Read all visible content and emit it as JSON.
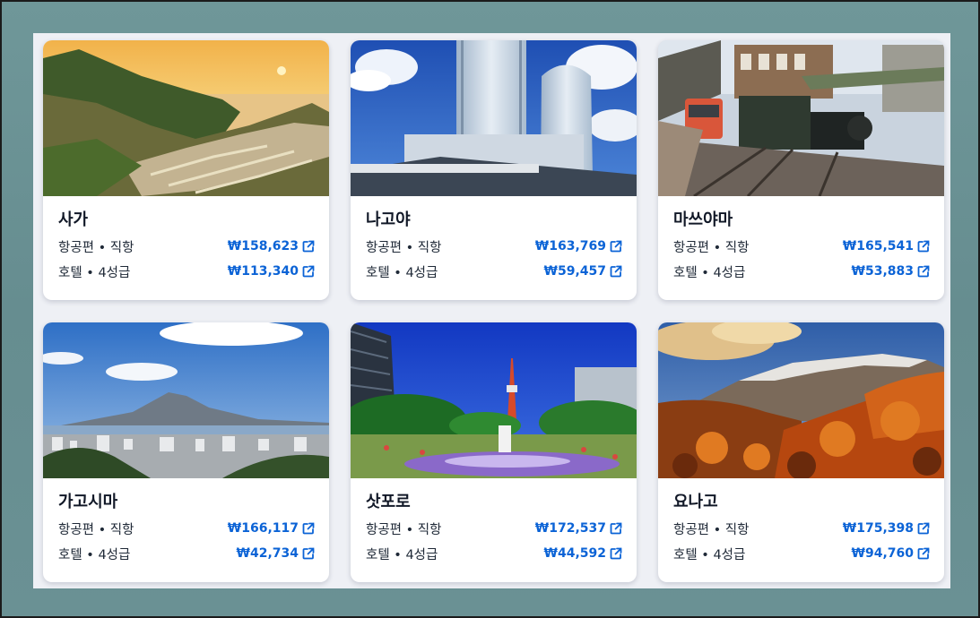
{
  "colors": {
    "accent": "#0b63d6",
    "text": "#1f2937",
    "panel": "#eef0f5"
  },
  "cards": [
    {
      "city": "사가",
      "flight_label": "항공편 • 직항",
      "flight_price": "₩158,623",
      "hotel_label": "호텔 • 4성급",
      "hotel_price": "₩113,340",
      "photo": "sunset-rice-terraces"
    },
    {
      "city": "나고야",
      "flight_label": "항공편 • 직항",
      "flight_price": "₩163,769",
      "hotel_label": "호텔 • 4성급",
      "hotel_price": "₩59,457",
      "photo": "station-towers"
    },
    {
      "city": "마쓰야마",
      "flight_label": "항공편 • 직항",
      "flight_price": "₩165,541",
      "hotel_label": "호텔 • 4성급",
      "hotel_price": "₩53,883",
      "photo": "botchan-train"
    },
    {
      "city": "가고시마",
      "flight_label": "항공편 • 직항",
      "flight_price": "₩166,117",
      "hotel_label": "호텔 • 4성급",
      "hotel_price": "₩42,734",
      "photo": "volcano-city"
    },
    {
      "city": "삿포로",
      "flight_label": "항공편 • 직항",
      "flight_price": "₩172,537",
      "hotel_label": "호텔 • 4성급",
      "hotel_price": "₩44,592",
      "photo": "tv-tower-park"
    },
    {
      "city": "요나고",
      "flight_label": "항공편 • 직항",
      "flight_price": "₩175,398",
      "hotel_label": "호텔 • 4성급",
      "hotel_price": "₩94,760",
      "photo": "autumn-mountain"
    }
  ],
  "icons": {
    "external_link": "external-link-icon"
  }
}
